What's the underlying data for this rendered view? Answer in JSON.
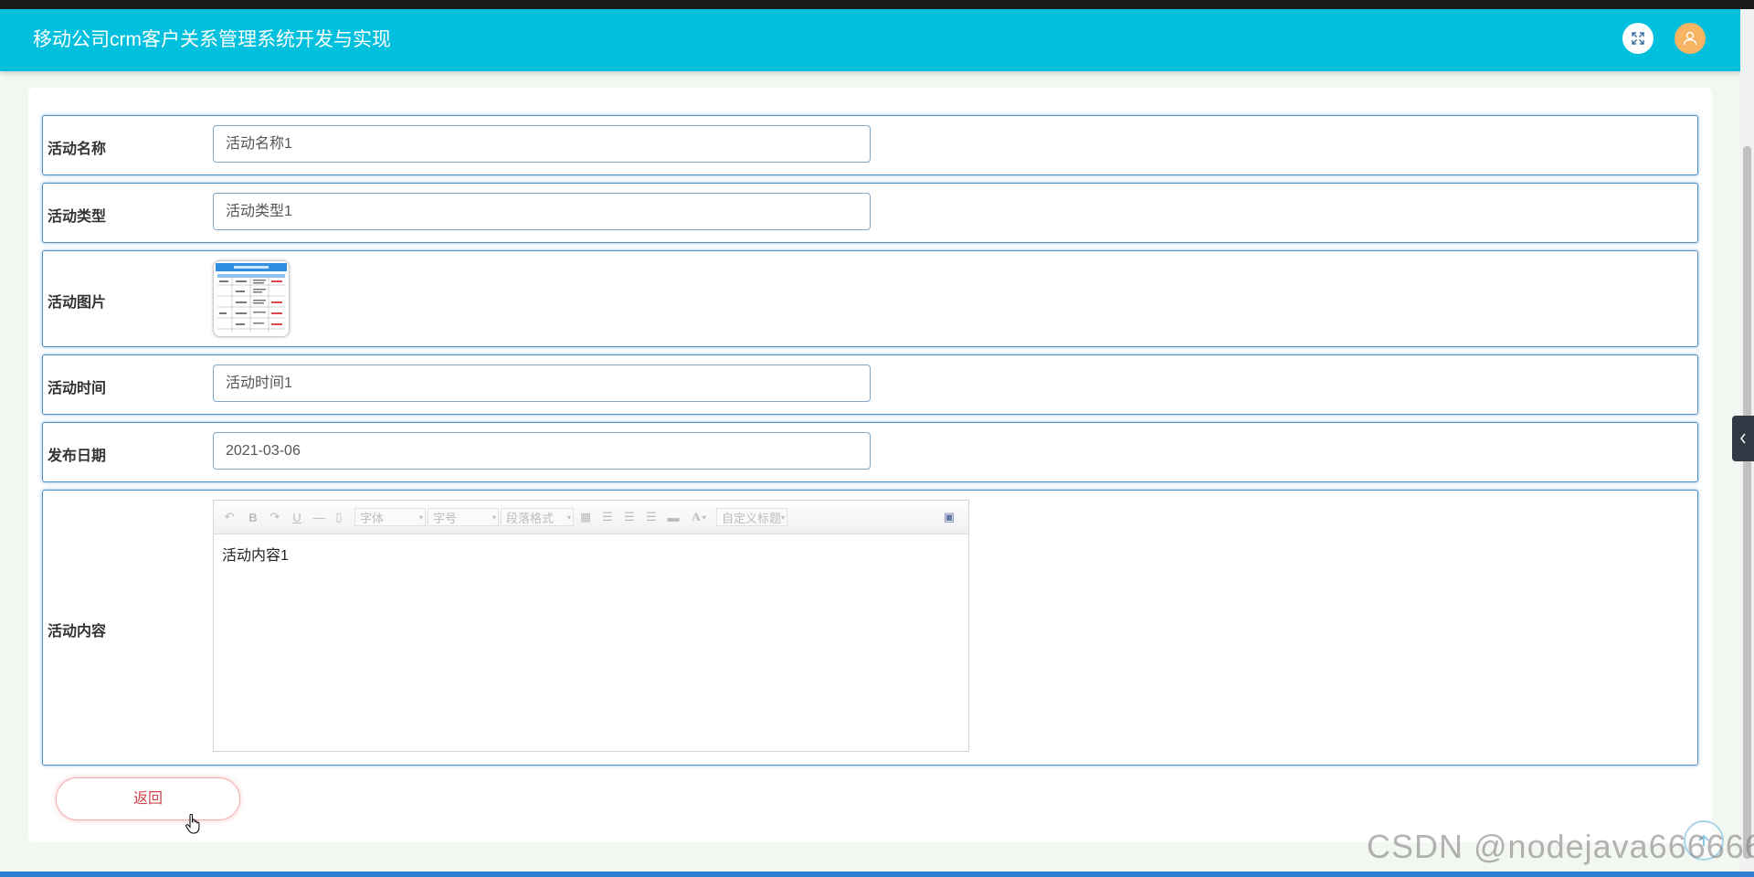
{
  "app": {
    "title": "移动公司crm客户关系管理系统开发与实现"
  },
  "header": {
    "fullscreen_icon": "fullscreen-icon",
    "user_icon": "user-avatar-icon",
    "accent": "#00c0de",
    "avatar_color": "#f7b462"
  },
  "form": {
    "name_label": "活动名称",
    "name_value": "活动名称1",
    "type_label": "活动类型",
    "type_value": "活动类型1",
    "image_label": "活动图片",
    "time_label": "活动时间",
    "time_value": "活动时间1",
    "date_label": "发布日期",
    "date_value": "2021-03-06",
    "content_label": "活动内容",
    "content_value": "活动内容1"
  },
  "editor_toolbar": {
    "font_family": "字体",
    "font_size": "字号",
    "paragraph": "段落格式",
    "custom_title": "自定义标题",
    "bold": "B",
    "underline": "U",
    "font_color": "A"
  },
  "buttons": {
    "back": "返回"
  },
  "watermark": "CSDN @nodejava666666"
}
